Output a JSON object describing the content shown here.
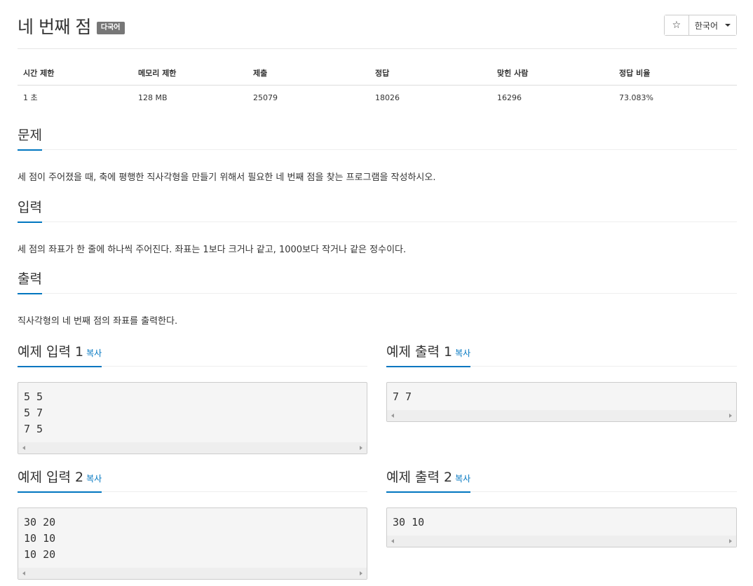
{
  "header": {
    "title": "네 번째 점",
    "badge": "다국어",
    "star_icon": "☆",
    "language": "한국어"
  },
  "stats": {
    "headers": [
      "시간 제한",
      "메모리 제한",
      "제출",
      "정답",
      "맞힌 사람",
      "정답 비율"
    ],
    "values": [
      "1 초",
      "128 MB",
      "25079",
      "18026",
      "16296",
      "73.083%"
    ]
  },
  "problem": {
    "heading": "문제",
    "text": "세 점이 주어졌을 때, 축에 평행한 직사각형을 만들기 위해서 필요한 네 번째 점을 찾는 프로그램을 작성하시오."
  },
  "input": {
    "heading": "입력",
    "text": "세 점의 좌표가 한 줄에 하나씩 주어진다. 좌표는 1보다 크거나 같고, 1000보다 작거나 같은 정수이다."
  },
  "output": {
    "heading": "출력",
    "text": "직사각형의 네 번째 점의 좌표를 출력한다."
  },
  "copy_label": "복사",
  "samples": {
    "in1": {
      "heading": "예제 입력 1",
      "content": "5 5\n5 7\n7 5"
    },
    "out1": {
      "heading": "예제 출력 1",
      "content": "7 7"
    },
    "in2": {
      "heading": "예제 입력 2",
      "content": "30 20\n10 10\n10 20"
    },
    "out2": {
      "heading": "예제 출력 2",
      "content": "30 10"
    }
  }
}
